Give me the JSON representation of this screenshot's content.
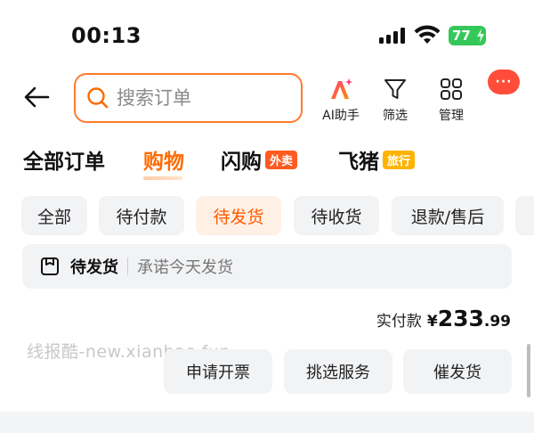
{
  "status_bar": {
    "time": "00:13",
    "battery": "77"
  },
  "search": {
    "placeholder": "搜索订单"
  },
  "toolbar": {
    "ai_label": "AI助手",
    "filter_label": "筛选",
    "manage_label": "管理",
    "chat_dots": "···"
  },
  "tabs": [
    {
      "label": "全部订单",
      "badge": ""
    },
    {
      "label": "购物",
      "badge": ""
    },
    {
      "label": "闪购",
      "badge": "外卖"
    },
    {
      "label": "飞猪",
      "badge": "旅行"
    }
  ],
  "active_tab": "购物",
  "sub_filters": [
    "全部",
    "待付款",
    "待发货",
    "待收货",
    "退款/售后"
  ],
  "active_sub_filter": "待发货",
  "order": {
    "status": "待发货",
    "promise": "承诺今天发货",
    "paid_label": "实付款",
    "currency": "¥",
    "price_int": "233",
    "price_dec": ".99",
    "actions": [
      "申请开票",
      "挑选服务",
      "催发货"
    ]
  },
  "watermark": "线报酷-new.xianbao.fun",
  "colors": {
    "accent": "#ff6a00",
    "search_border": "#ff7a2e",
    "badge_red": "#ff5a1f",
    "badge_yellow": "#ffb300",
    "chat": "#ff4d3a",
    "battery": "#34c759"
  }
}
